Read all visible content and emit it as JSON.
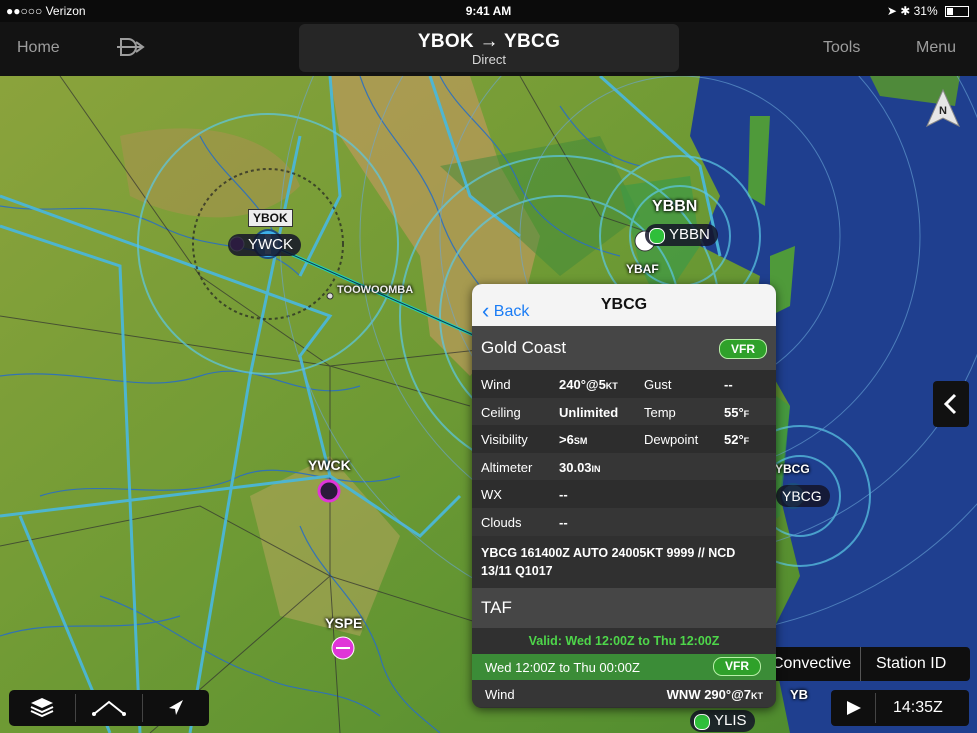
{
  "status_bar": {
    "carrier": "●●○○○ Verizon",
    "time": "9:41 AM",
    "battery": "31%",
    "battery_level": 0.31
  },
  "nav": {
    "home_label": "Home",
    "route": "YBOK → YBCG",
    "route_mode": "Direct",
    "tools_label": "Tools",
    "menu_label": "Menu"
  },
  "map": {
    "compass_label": "N",
    "waypoints": {
      "ybok": "YBOK",
      "ybok_pill": "YWCK",
      "toowoomba": "TOOWOOMBA",
      "ybbn": "YBBN",
      "ybbn_pill": "YBBN",
      "ybaf": "YBAF",
      "ywck": "YWCK",
      "yspe": "YSPE",
      "ybcg": "YBCG",
      "ybcg_pill": "YBCG",
      "ylis": "YLIS",
      "yb_partial": "YB"
    },
    "overlay_controls": {
      "convective": "Convective",
      "station_id": "Station ID"
    },
    "playback_time": "14:35Z"
  },
  "popup": {
    "back_label": "Back",
    "title": "YBCG",
    "station_name": "Gold Coast",
    "flight_category": "VFR",
    "rows": [
      {
        "l1": "Wind",
        "v1": "240°@5",
        "u1": "KT",
        "l2": "Gust",
        "v2": "--",
        "u2": ""
      },
      {
        "l1": "Ceiling",
        "v1": "Unlimited",
        "u1": "",
        "l2": "Temp",
        "v2": "55°",
        "u2": "F"
      },
      {
        "l1": "Visibility",
        "v1": ">6",
        "u1": "SM",
        "l2": "Dewpoint",
        "v2": "52°",
        "u2": "F"
      },
      {
        "l1": "Altimeter",
        "v1": "30.03",
        "u1": "IN",
        "l2": "",
        "v2": "",
        "u2": ""
      },
      {
        "l1": "WX",
        "v1": "--",
        "u1": "",
        "l2": "",
        "v2": "",
        "u2": ""
      },
      {
        "l1": "Clouds",
        "v1": "--",
        "u1": "",
        "l2": "",
        "v2": "",
        "u2": ""
      }
    ],
    "metar": "YBCG 161400Z AUTO 24005KT 9999 // NCD 13/11 Q1017",
    "taf_label": "TAF",
    "taf_valid": "Valid: Wed 12:00Z to Thu 12:00Z",
    "taf_period": "Wed 12:00Z to Thu 00:00Z",
    "taf_category": "VFR",
    "taf_wind_label": "Wind",
    "taf_wind_value": "WNW 290°@7",
    "taf_wind_unit": "KT"
  }
}
